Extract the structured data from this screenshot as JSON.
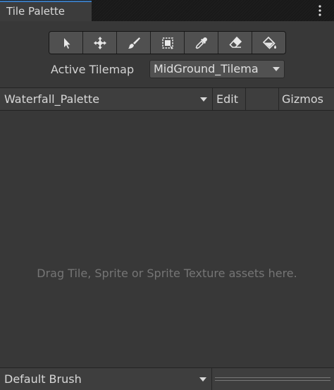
{
  "window": {
    "tab_title": "Tile Palette",
    "menu_icon": "kebab-menu-icon"
  },
  "toolbar": {
    "tools": [
      {
        "id": "select",
        "icon": "arrow-cursor-icon"
      },
      {
        "id": "move",
        "icon": "move-arrows-icon"
      },
      {
        "id": "paint",
        "icon": "paintbrush-icon"
      },
      {
        "id": "box-fill",
        "icon": "box-fill-icon"
      },
      {
        "id": "pick",
        "icon": "eyedropper-icon"
      },
      {
        "id": "erase",
        "icon": "eraser-icon"
      },
      {
        "id": "fill",
        "icon": "paint-bucket-icon"
      }
    ]
  },
  "active_tilemap": {
    "label": "Active Tilemap",
    "value": "MidGround_Tilema"
  },
  "palette": {
    "selected": "Waterfall_Palette",
    "edit_label": "Edit",
    "gizmos_label": "Gizmos"
  },
  "drop_area": {
    "hint": "Drag Tile, Sprite or Sprite Texture assets here."
  },
  "brush": {
    "selected": "Default Brush"
  },
  "colors": {
    "background": "#383838",
    "tab_highlight": "#3a79bb",
    "hint_text": "#757575"
  }
}
